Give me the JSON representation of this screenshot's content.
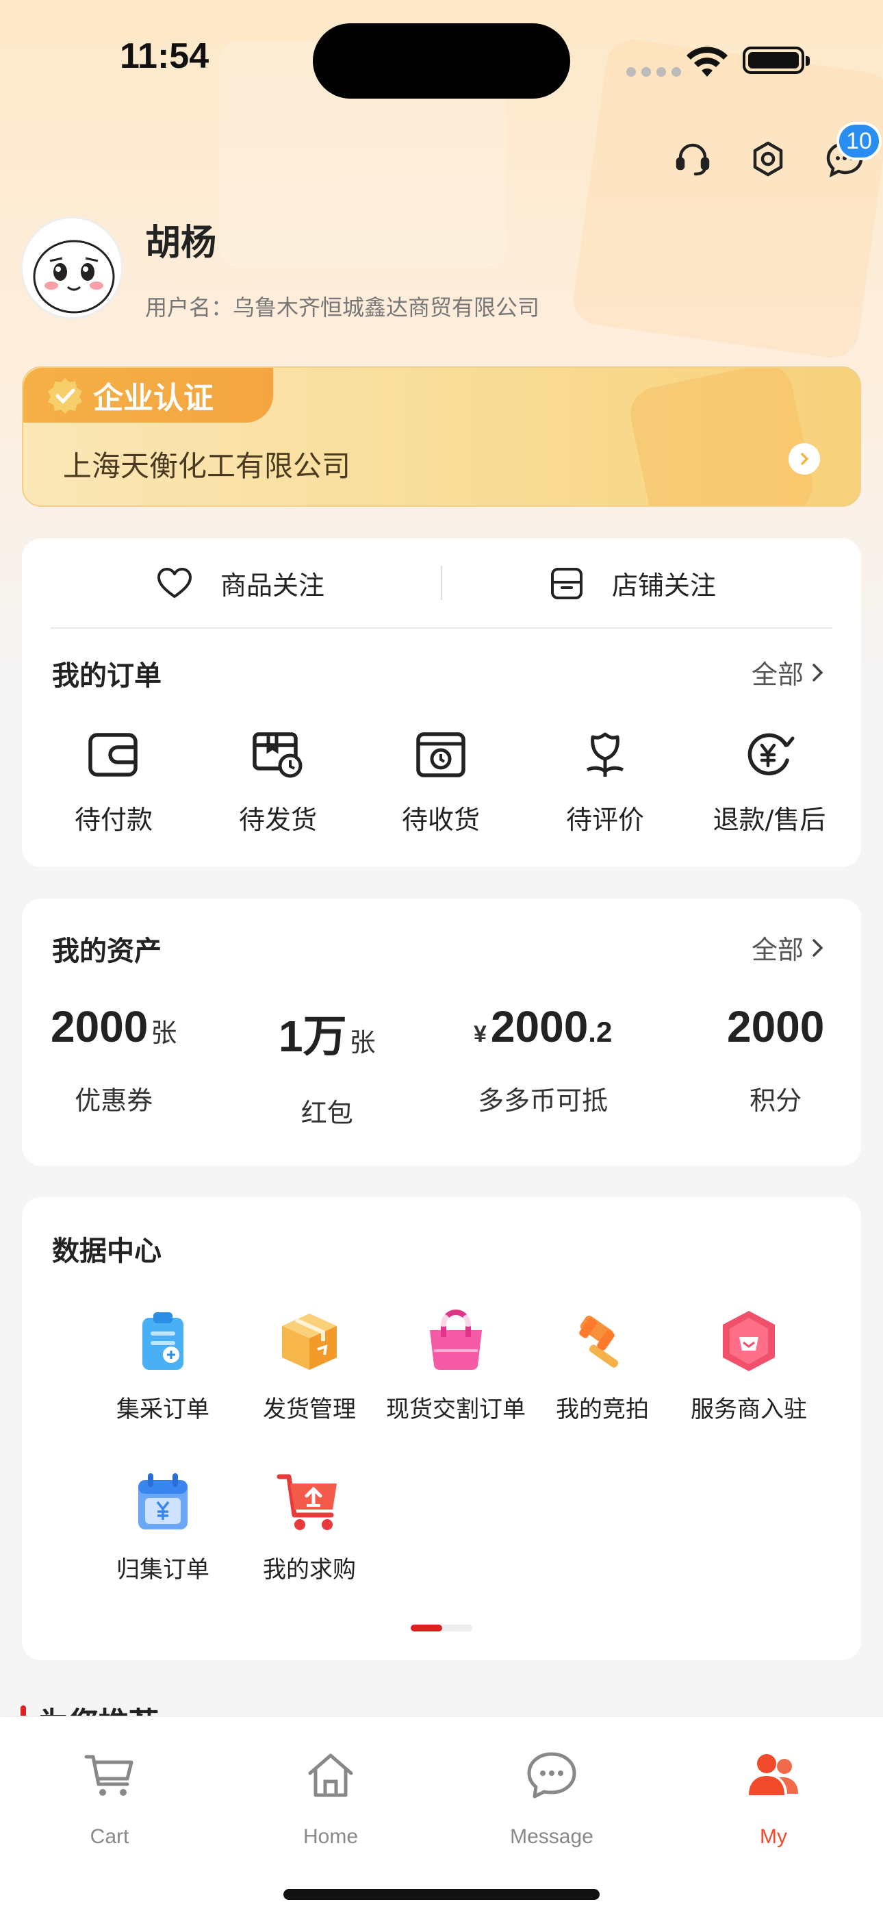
{
  "status_bar": {
    "time": "11:54"
  },
  "header": {
    "message_badge": "10"
  },
  "profile": {
    "name": "胡杨",
    "username": "用户名：乌鲁木齐恒城鑫达商贸有限公司"
  },
  "enterprise": {
    "tag_label": "企业认证",
    "company": "上海天衡化工有限公司"
  },
  "follow": {
    "product_label": "商品关注",
    "store_label": "店铺关注"
  },
  "orders": {
    "title": "我的订单",
    "more_label": "全部",
    "items": [
      {
        "label": "待付款",
        "icon": "wallet-icon"
      },
      {
        "label": "待发货",
        "icon": "ship-clock-icon"
      },
      {
        "label": "待收货",
        "icon": "receive-box-icon"
      },
      {
        "label": "待评价",
        "icon": "flower-review-icon"
      },
      {
        "label": "退款/售后",
        "icon": "refund-yen-icon"
      }
    ]
  },
  "assets": {
    "title": "我的资产",
    "more_label": "全部",
    "items": [
      {
        "value": "2000",
        "unit": "张",
        "label": "优惠券"
      },
      {
        "value": "1万",
        "unit": "张",
        "label": "红包"
      },
      {
        "currency": "¥",
        "value": "2000",
        "decimal": ".2",
        "label": "多多币可抵"
      },
      {
        "value": "2000",
        "label": "积分"
      }
    ]
  },
  "data_center": {
    "title": "数据中心",
    "items": [
      {
        "label": "集采订单",
        "icon": "clipboard-icon",
        "color": "#3aa6f0"
      },
      {
        "label": "发货管理",
        "icon": "package-icon",
        "color": "#f5a431"
      },
      {
        "label": "现货交割订单",
        "icon": "bag-icon",
        "color": "#f0509a"
      },
      {
        "label": "我的竞拍",
        "icon": "gavel-icon",
        "color": "#f58a3a"
      },
      {
        "label": "服务商入驻",
        "icon": "shield-icon",
        "color": "#f0506a"
      },
      {
        "label": "归集订单",
        "icon": "calendar-yen-icon",
        "color": "#5a9cf5"
      },
      {
        "label": "我的求购",
        "icon": "cart-upload-icon",
        "color": "#f04a3a"
      }
    ]
  },
  "recommend": {
    "title": "为您推荐"
  },
  "tabbar": {
    "items": [
      {
        "label": "Cart"
      },
      {
        "label": "Home"
      },
      {
        "label": "Message"
      },
      {
        "label": "My"
      }
    ],
    "active_color": "#f04a2a"
  }
}
